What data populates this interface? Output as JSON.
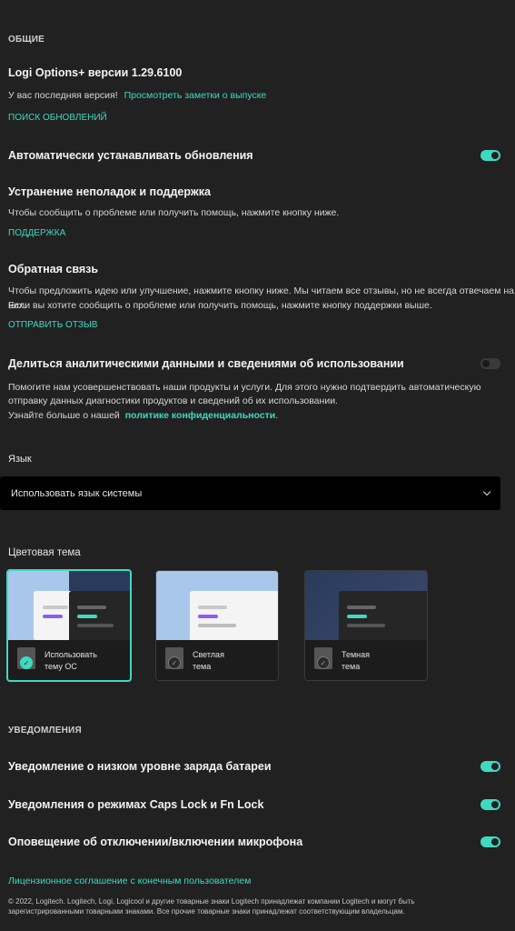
{
  "general": {
    "section_title": "ОБЩИЕ",
    "app_version": "Logi Options+ версии 1.29.6100",
    "latest_text": "У вас последняя версия!",
    "release_notes_link": "Просмотреть заметки о выпуске",
    "check_updates": "ПОИСК ОБНОВЛЕНИЙ",
    "auto_update_label": "Автоматически устанавливать обновления",
    "auto_update_on": true
  },
  "support": {
    "title": "Устранение неполадок и поддержка",
    "description": "Чтобы сообщить о проблеме или получить помощь, нажмите кнопку ниже.",
    "button": "ПОДДЕРЖКА"
  },
  "feedback": {
    "title": "Обратная связь",
    "line1": "Чтобы предложить идею или улучшение, нажмите кнопку ниже. Мы читаем все отзывы, но не всегда отвечаем на них.",
    "line2": "Если вы хотите сообщить о проблеме или получить помощь, нажмите кнопку поддержки выше.",
    "button": "ОТПРАВИТЬ ОТЗЫВ"
  },
  "analytics": {
    "title": "Делиться аналитическими данными и сведениями об использовании",
    "enabled": false,
    "line1": "Помогите нам усовершенствовать наши продукты и услуги. Для этого нужно подтвердить автоматическую",
    "line2": "отправку данных диагностики продуктов и сведений об их использовании.",
    "line3_prefix": "Узнайте больше о нашей",
    "privacy_link": "политике конфиденциальности",
    "line3_suffix": "."
  },
  "language": {
    "title": "Язык",
    "selected": "Использовать язык системы"
  },
  "theme": {
    "title": "Цветовая тема",
    "options": [
      {
        "line1": "Использовать",
        "line2": "тему ОС",
        "selected": true
      },
      {
        "line1": "Светлая",
        "line2": "тема",
        "selected": false
      },
      {
        "line1": "Темная",
        "line2": "тема",
        "selected": false
      }
    ],
    "colors": {
      "accent": "#3fd9c2",
      "purple": "#8a5cf5",
      "light_bg": "#a9c7ea",
      "dark_bg": "#2a3a5a"
    }
  },
  "notifications": {
    "section_title": "УВЕДОМЛЕНИЯ",
    "items": [
      {
        "label": "Уведомление о низком уровне заряда батареи",
        "on": true
      },
      {
        "label": "Уведомления о режимах Caps Lock и Fn Lock",
        "on": true
      },
      {
        "label": "Оповещение об отключении/включении микрофона",
        "on": true
      }
    ]
  },
  "footer": {
    "eula_link": "Лицензионное соглашение с конечным пользователем",
    "copyright_line1": "© 2022, Logitech. Logitech, Logi, Logicool и другие товарные знаки Logitech принадлежат компании Logitech и могут быть",
    "copyright_line2": "зарегистрированными товарными знаками. Все прочие товарные знаки принадлежат соответствующим владельцам."
  }
}
